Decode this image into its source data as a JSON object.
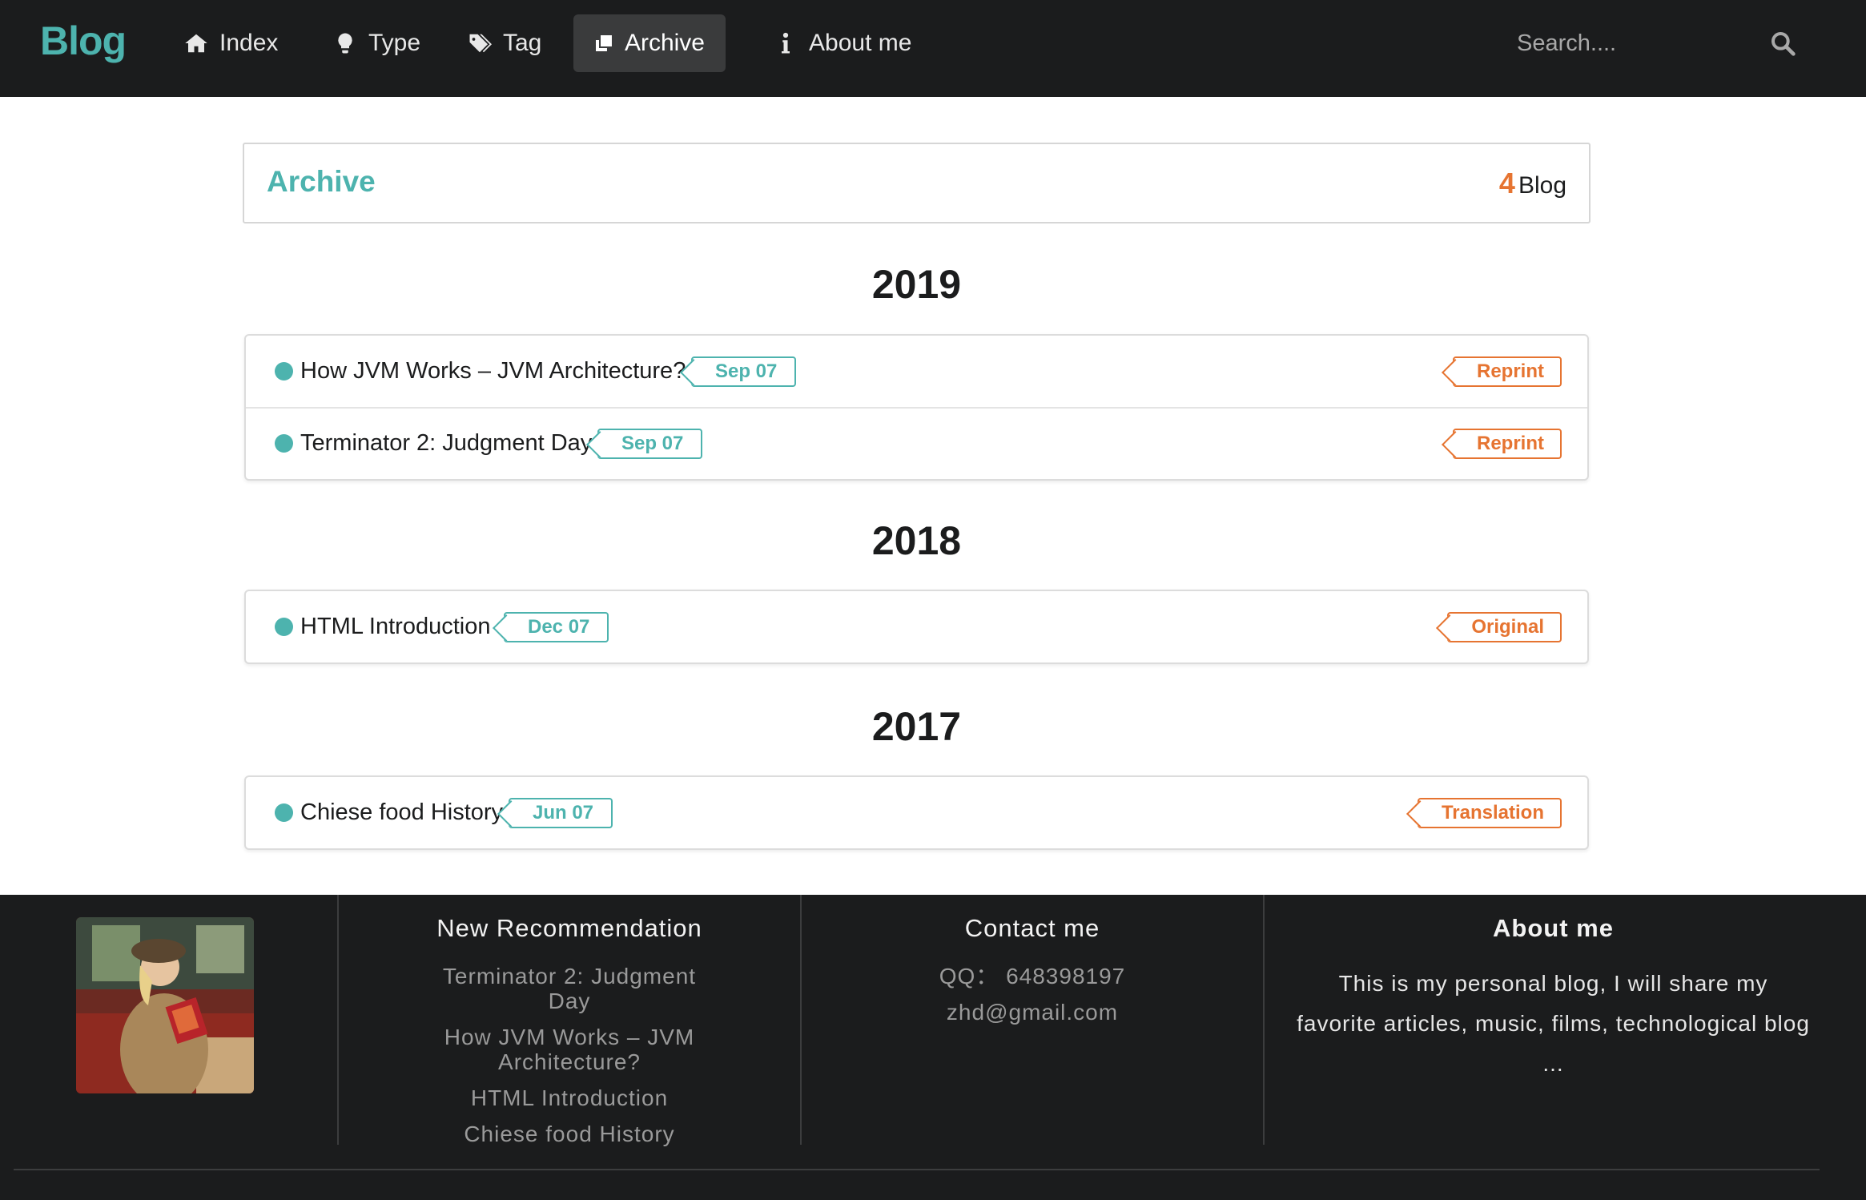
{
  "nav": {
    "brand": "Blog",
    "items": [
      {
        "label": "Index",
        "icon": "home-icon"
      },
      {
        "label": "Type",
        "icon": "lightbulb-icon"
      },
      {
        "label": "Tag",
        "icon": "tags-icon"
      },
      {
        "label": "Archive",
        "icon": "clone-icon",
        "active": true
      },
      {
        "label": "About me",
        "icon": "info-icon"
      }
    ],
    "search_placeholder": "Search...."
  },
  "archive": {
    "title": "Archive",
    "count": "4",
    "count_label": "Blog"
  },
  "years": [
    {
      "year": "2019",
      "posts": [
        {
          "title": "How JVM Works – JVM Architecture?",
          "date": "Sep 07",
          "type": "Reprint"
        },
        {
          "title": "Terminator 2: Judgment Day",
          "date": "Sep 07",
          "type": "Reprint"
        }
      ]
    },
    {
      "year": "2018",
      "posts": [
        {
          "title": "HTML Introduction",
          "date": "Dec 07",
          "type": "Original"
        }
      ]
    },
    {
      "year": "2017",
      "posts": [
        {
          "title": "Chiese food History",
          "date": "Jun 07",
          "type": "Translation"
        }
      ]
    }
  ],
  "footer": {
    "recommendation": {
      "title": "New Recommendation",
      "links": [
        "Terminator 2: Judgment Day",
        "How JVM Works – JVM Architecture?",
        "HTML Introduction",
        "Chiese food History"
      ]
    },
    "contact": {
      "title": "Contact me",
      "qq": "QQ： 648398197",
      "email": "zhd@gmail.com"
    },
    "about": {
      "title": "About me",
      "text": "This is my personal blog, I will share my favorite articles, music, films, technological blog ..."
    }
  },
  "colors": {
    "accent": "#4db3ae",
    "orange": "#e67431",
    "dark": "#1b1c1d"
  }
}
